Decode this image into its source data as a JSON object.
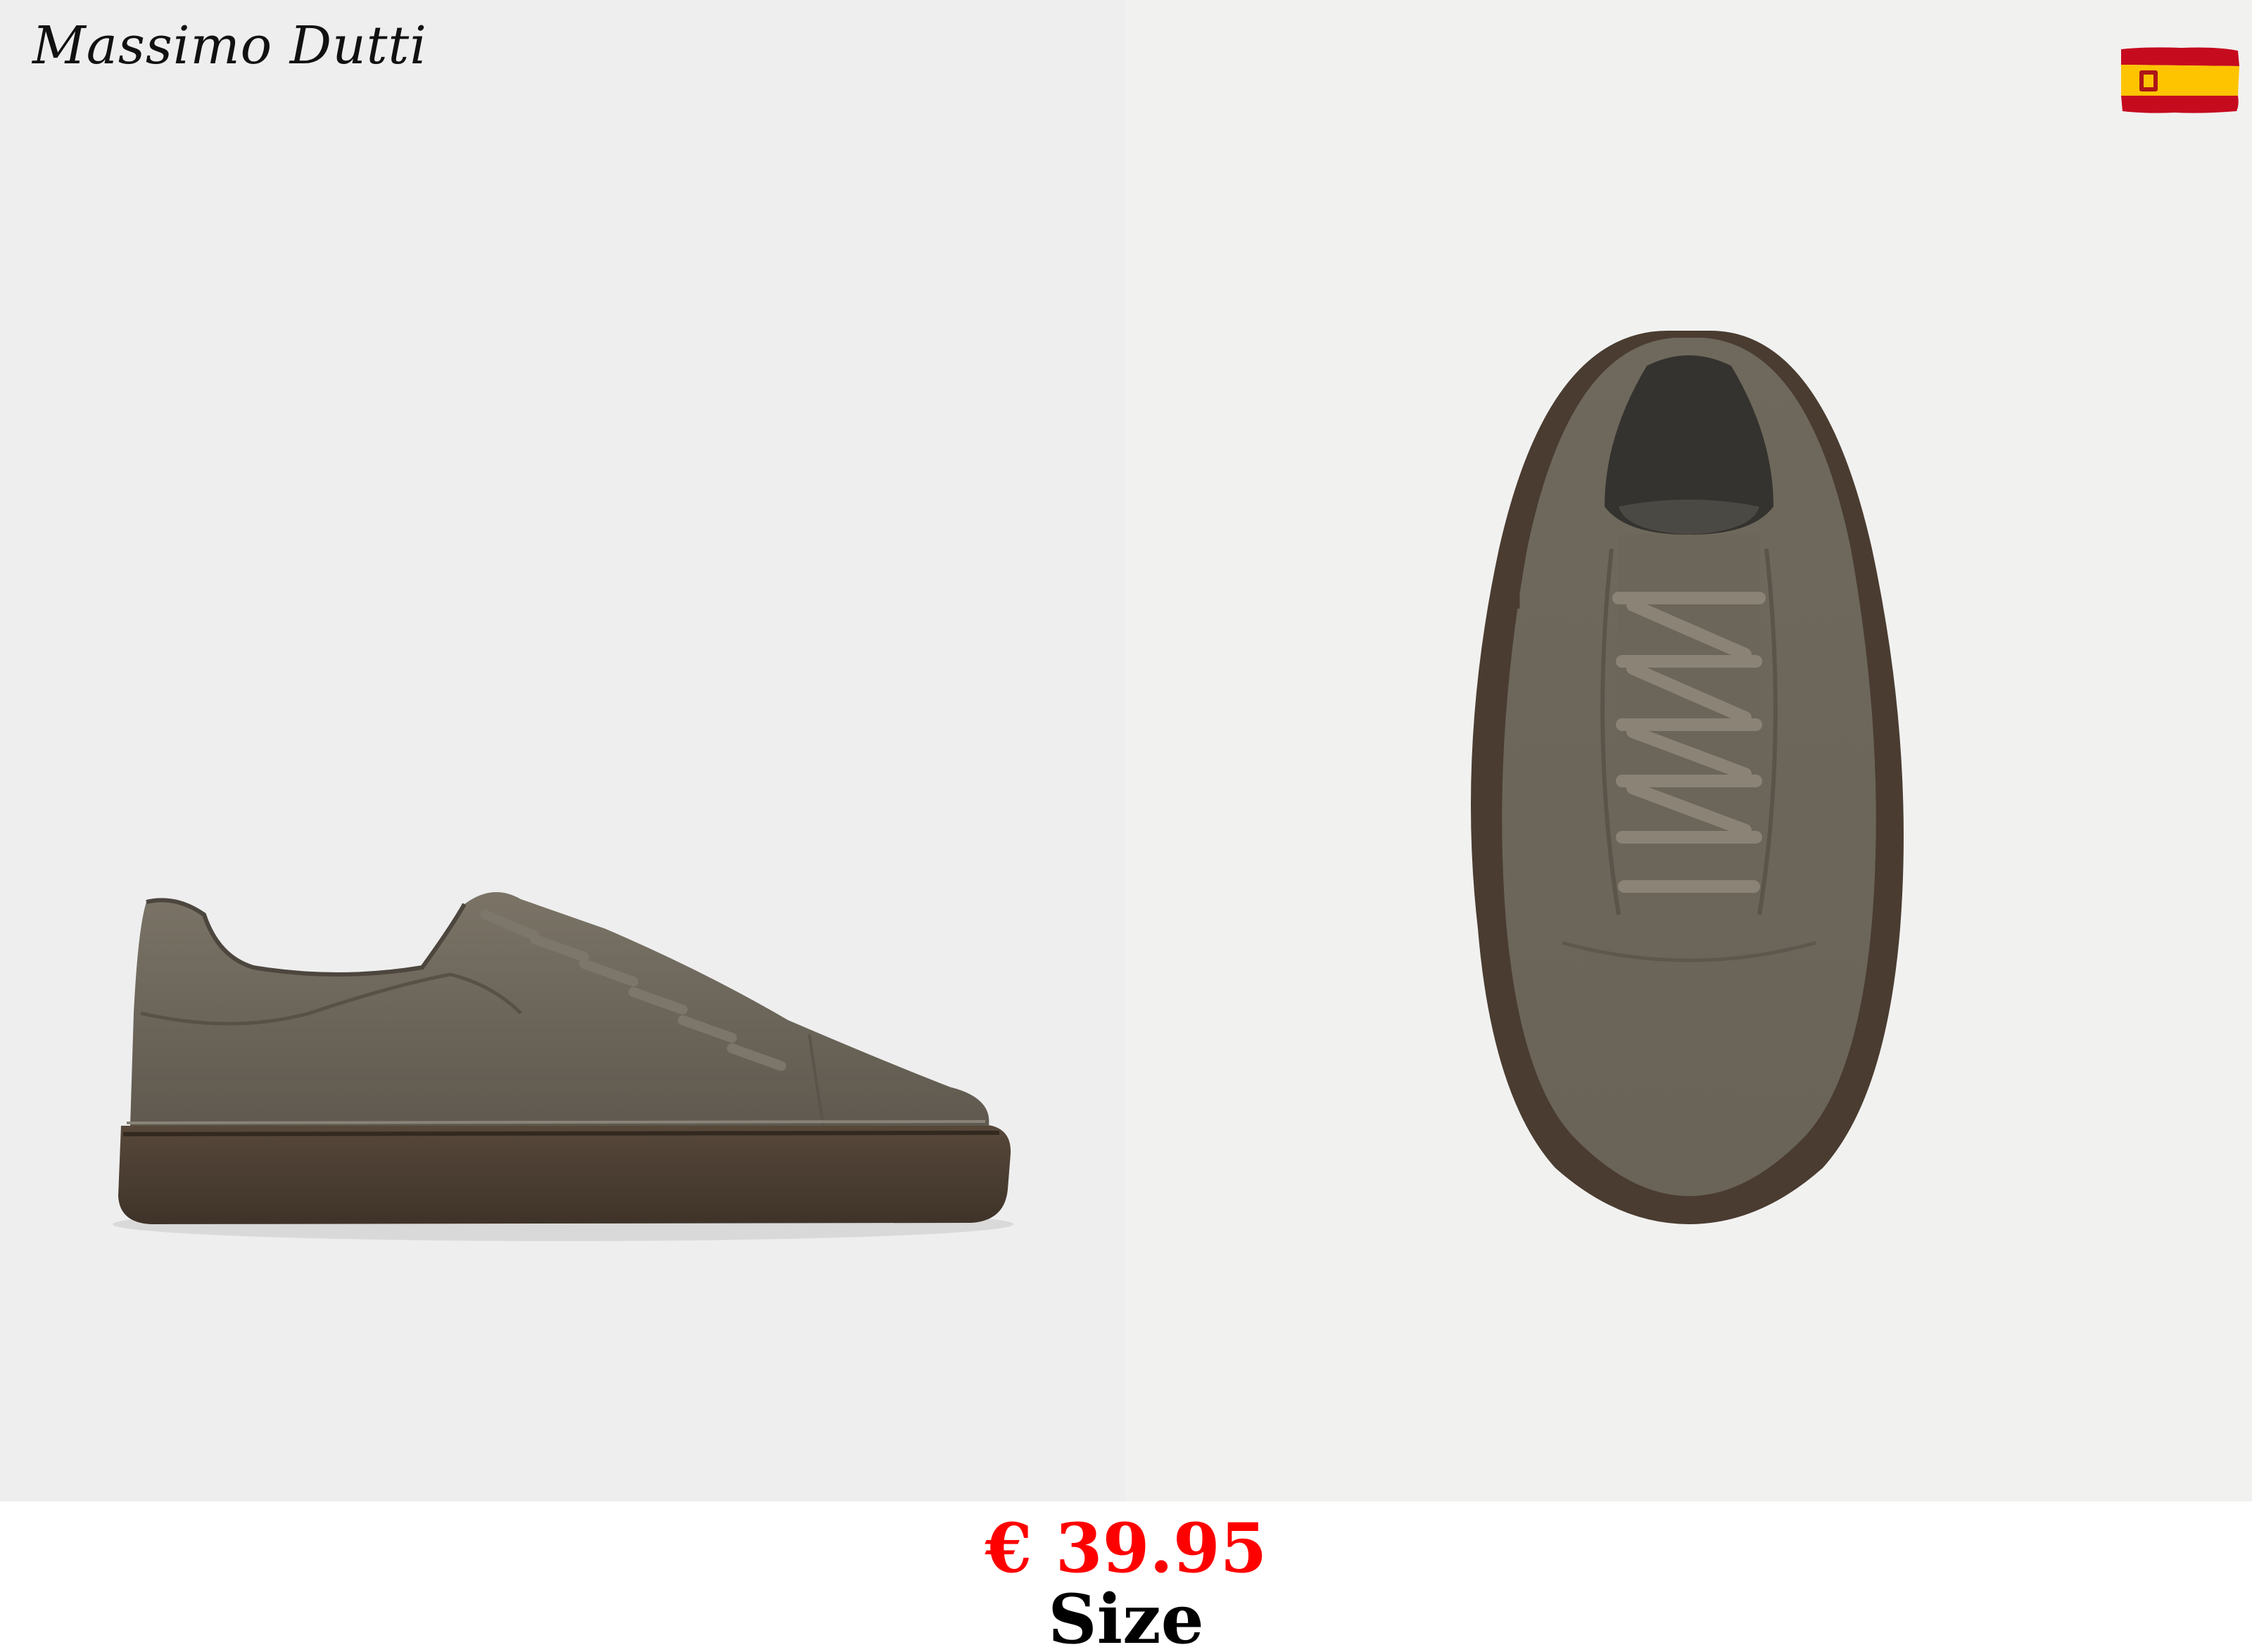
{
  "header": {
    "brand_logo": "Massimo Dutti",
    "language_flag": "spain-flag-icon"
  },
  "gallery": {
    "images": [
      {
        "view": "side",
        "subject": "sneaker"
      },
      {
        "view": "top",
        "subject": "sneaker"
      }
    ]
  },
  "product": {
    "price": "€ 39.95",
    "size_label": "Size"
  },
  "colors": {
    "price": "#ff0000",
    "suede": "#6e675c",
    "sole": "#4a3c30",
    "flag_red": "#c60b1e",
    "flag_yellow": "#ffc400"
  }
}
